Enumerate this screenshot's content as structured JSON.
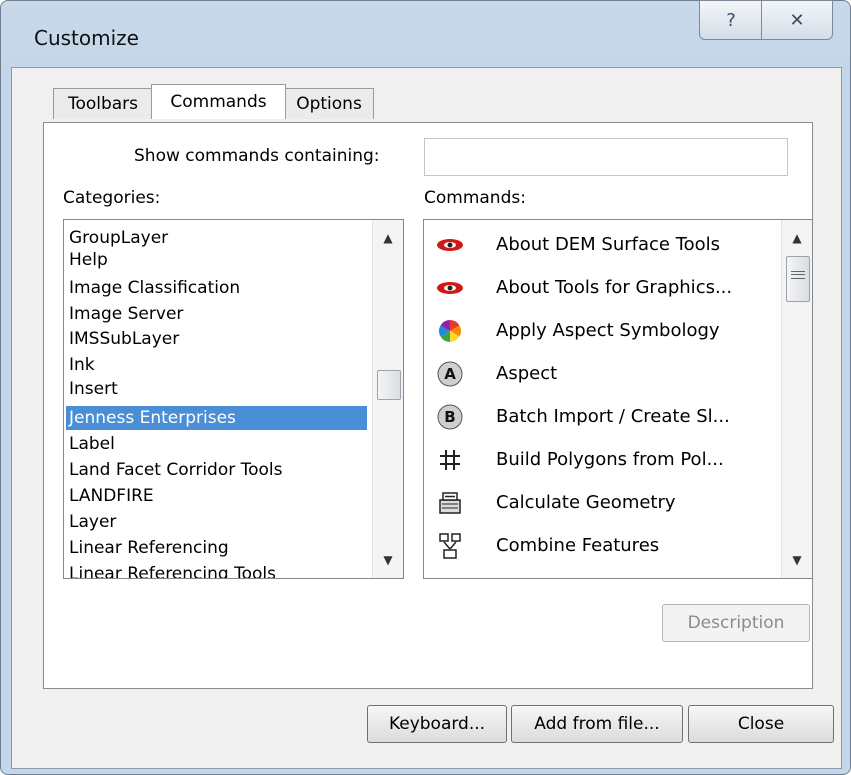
{
  "window": {
    "title": "Customize",
    "help_glyph": "?",
    "close_glyph": "✕"
  },
  "tabs": [
    {
      "label": "Toolbars"
    },
    {
      "label": "Commands"
    },
    {
      "label": "Options"
    }
  ],
  "search": {
    "label": "Show commands containing:",
    "value": ""
  },
  "categories": {
    "label": "Categories:",
    "items": [
      "GroupLayer",
      "Help",
      "Image Classification",
      "Image Server",
      "IMSSubLayer",
      "Ink",
      "Insert",
      "Jenness Enterprises",
      "Label",
      "Land Facet Corridor Tools",
      "LANDFIRE",
      "Layer",
      "Linear Referencing",
      "Linear Referencing Tools"
    ],
    "selected": "Jenness Enterprises"
  },
  "commands": {
    "label": "Commands:",
    "items": [
      {
        "label": "About DEM Surface Tools",
        "icon": "red-eye-icon"
      },
      {
        "label": "About Tools for Graphics...",
        "icon": "red-eye-icon"
      },
      {
        "label": "Apply Aspect Symbology",
        "icon": "color-wheel-icon"
      },
      {
        "label": "Aspect",
        "icon": "letter-a-icon",
        "glyph": "A"
      },
      {
        "label": "Batch Import / Create Sl...",
        "icon": "letter-b-icon",
        "glyph": "B"
      },
      {
        "label": "Build Polygons from Pol...",
        "icon": "grid-hash-icon"
      },
      {
        "label": "Calculate Geometry",
        "icon": "calculator-icon"
      },
      {
        "label": "Combine Features",
        "icon": "combine-features-icon"
      }
    ]
  },
  "buttons": {
    "description": "Description",
    "keyboard": "Keyboard...",
    "add_from_file": "Add from file...",
    "close": "Close"
  }
}
